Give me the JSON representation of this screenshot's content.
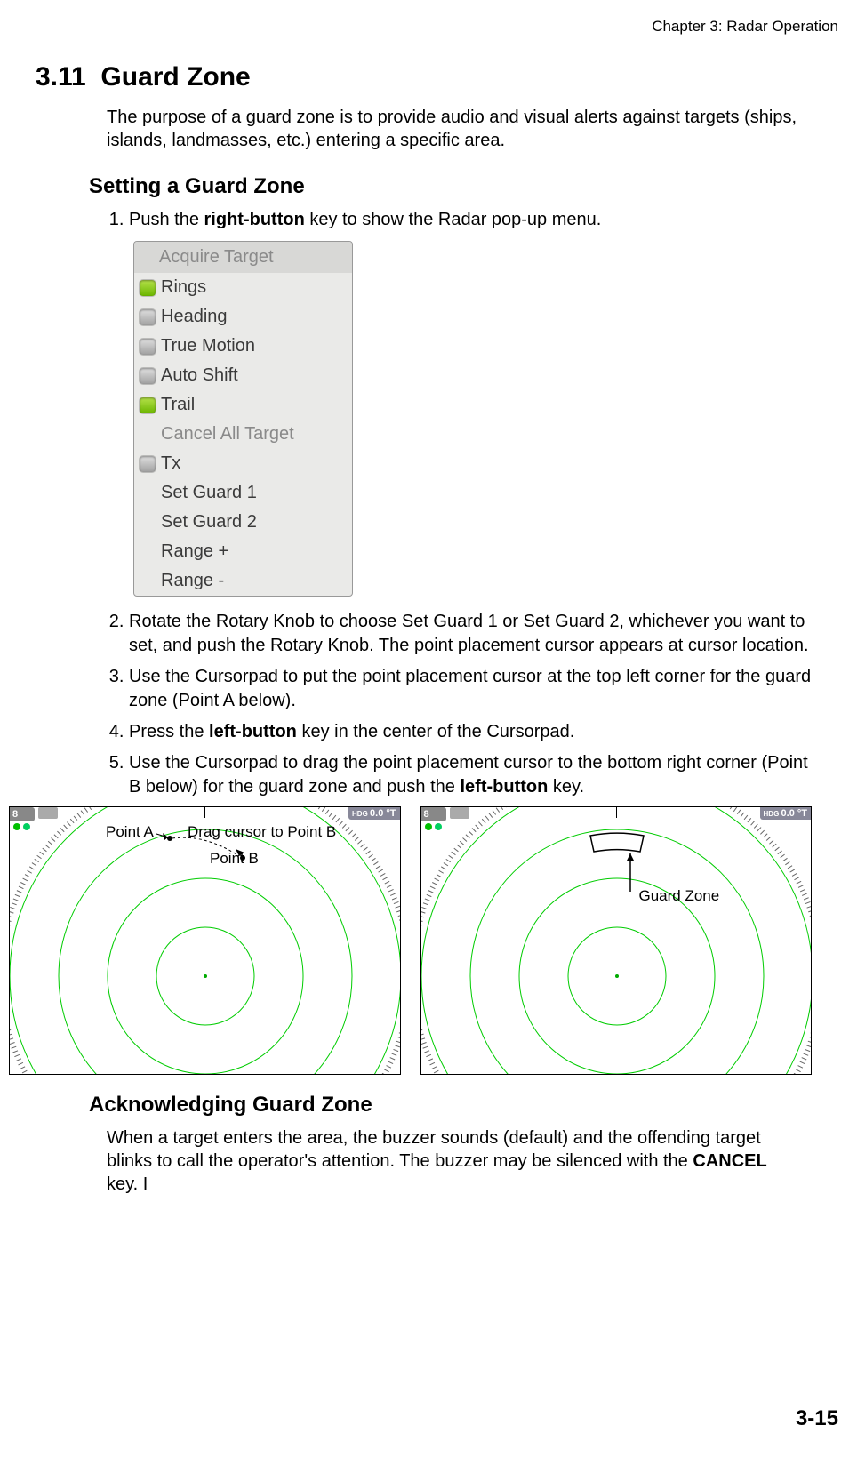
{
  "header": {
    "chapter": "Chapter 3: Radar Operation"
  },
  "section": {
    "number": "3.11",
    "title": "Guard Zone"
  },
  "intro": "The purpose of a guard zone is to provide audio and visual alerts against targets (ships, islands, landmasses, etc.) entering a specific area.",
  "subheading1": "Setting a Guard Zone",
  "steps": {
    "s1a": "Push the ",
    "s1b": "right-button",
    "s1c": " key to show the Radar pop-up menu.",
    "s2": "Rotate the Rotary Knob to choose Set Guard 1 or Set Guard 2, whichever you want to set, and push the Rotary Knob. The point placement cursor appears at cursor location.",
    "s3": "Use the Cursorpad to put the point placement cursor at the top left corner for the guard zone (Point A below).",
    "s4a": "Press the ",
    "s4b": "left-button",
    "s4c": " key in the center of the Cursorpad.",
    "s5a": "Use the Cursorpad to drag the point placement cursor to the bottom right corner (Point B below) for the guard zone and push the ",
    "s5b": "left-button",
    "s5c": " key."
  },
  "popup": {
    "top": "Acquire Target",
    "items": [
      {
        "label": "Rings",
        "toggle": "on"
      },
      {
        "label": "Heading",
        "toggle": "off"
      },
      {
        "label": "True Motion",
        "toggle": "off"
      },
      {
        "label": "Auto Shift",
        "toggle": "off"
      },
      {
        "label": "Trail",
        "toggle": "on"
      },
      {
        "label": "Cancel All Target",
        "toggle": null,
        "disabled": true
      },
      {
        "label": "Tx",
        "toggle": "off"
      },
      {
        "label": "Set Guard 1",
        "toggle": null
      },
      {
        "label": "Set Guard 2",
        "toggle": null
      },
      {
        "label": "Range +",
        "toggle": null
      },
      {
        "label": "Range -",
        "toggle": null
      }
    ]
  },
  "radar": {
    "range": "8",
    "hdg": "0.0 °T",
    "left": {
      "pointA": "Point A",
      "drag": "Drag cursor to Point B",
      "pointB": "Point B"
    },
    "right": {
      "guardZone": "Guard Zone"
    }
  },
  "subheading2": "Acknowledging Guard Zone",
  "ack": {
    "p1a": "When a target enters the area, the buzzer sounds (default) and the offending target blinks to call the operator's attention. The buzzer may be silenced with the ",
    "p1b": "CANCEL",
    "p1c": " key. I"
  },
  "pagenum": "3-15"
}
